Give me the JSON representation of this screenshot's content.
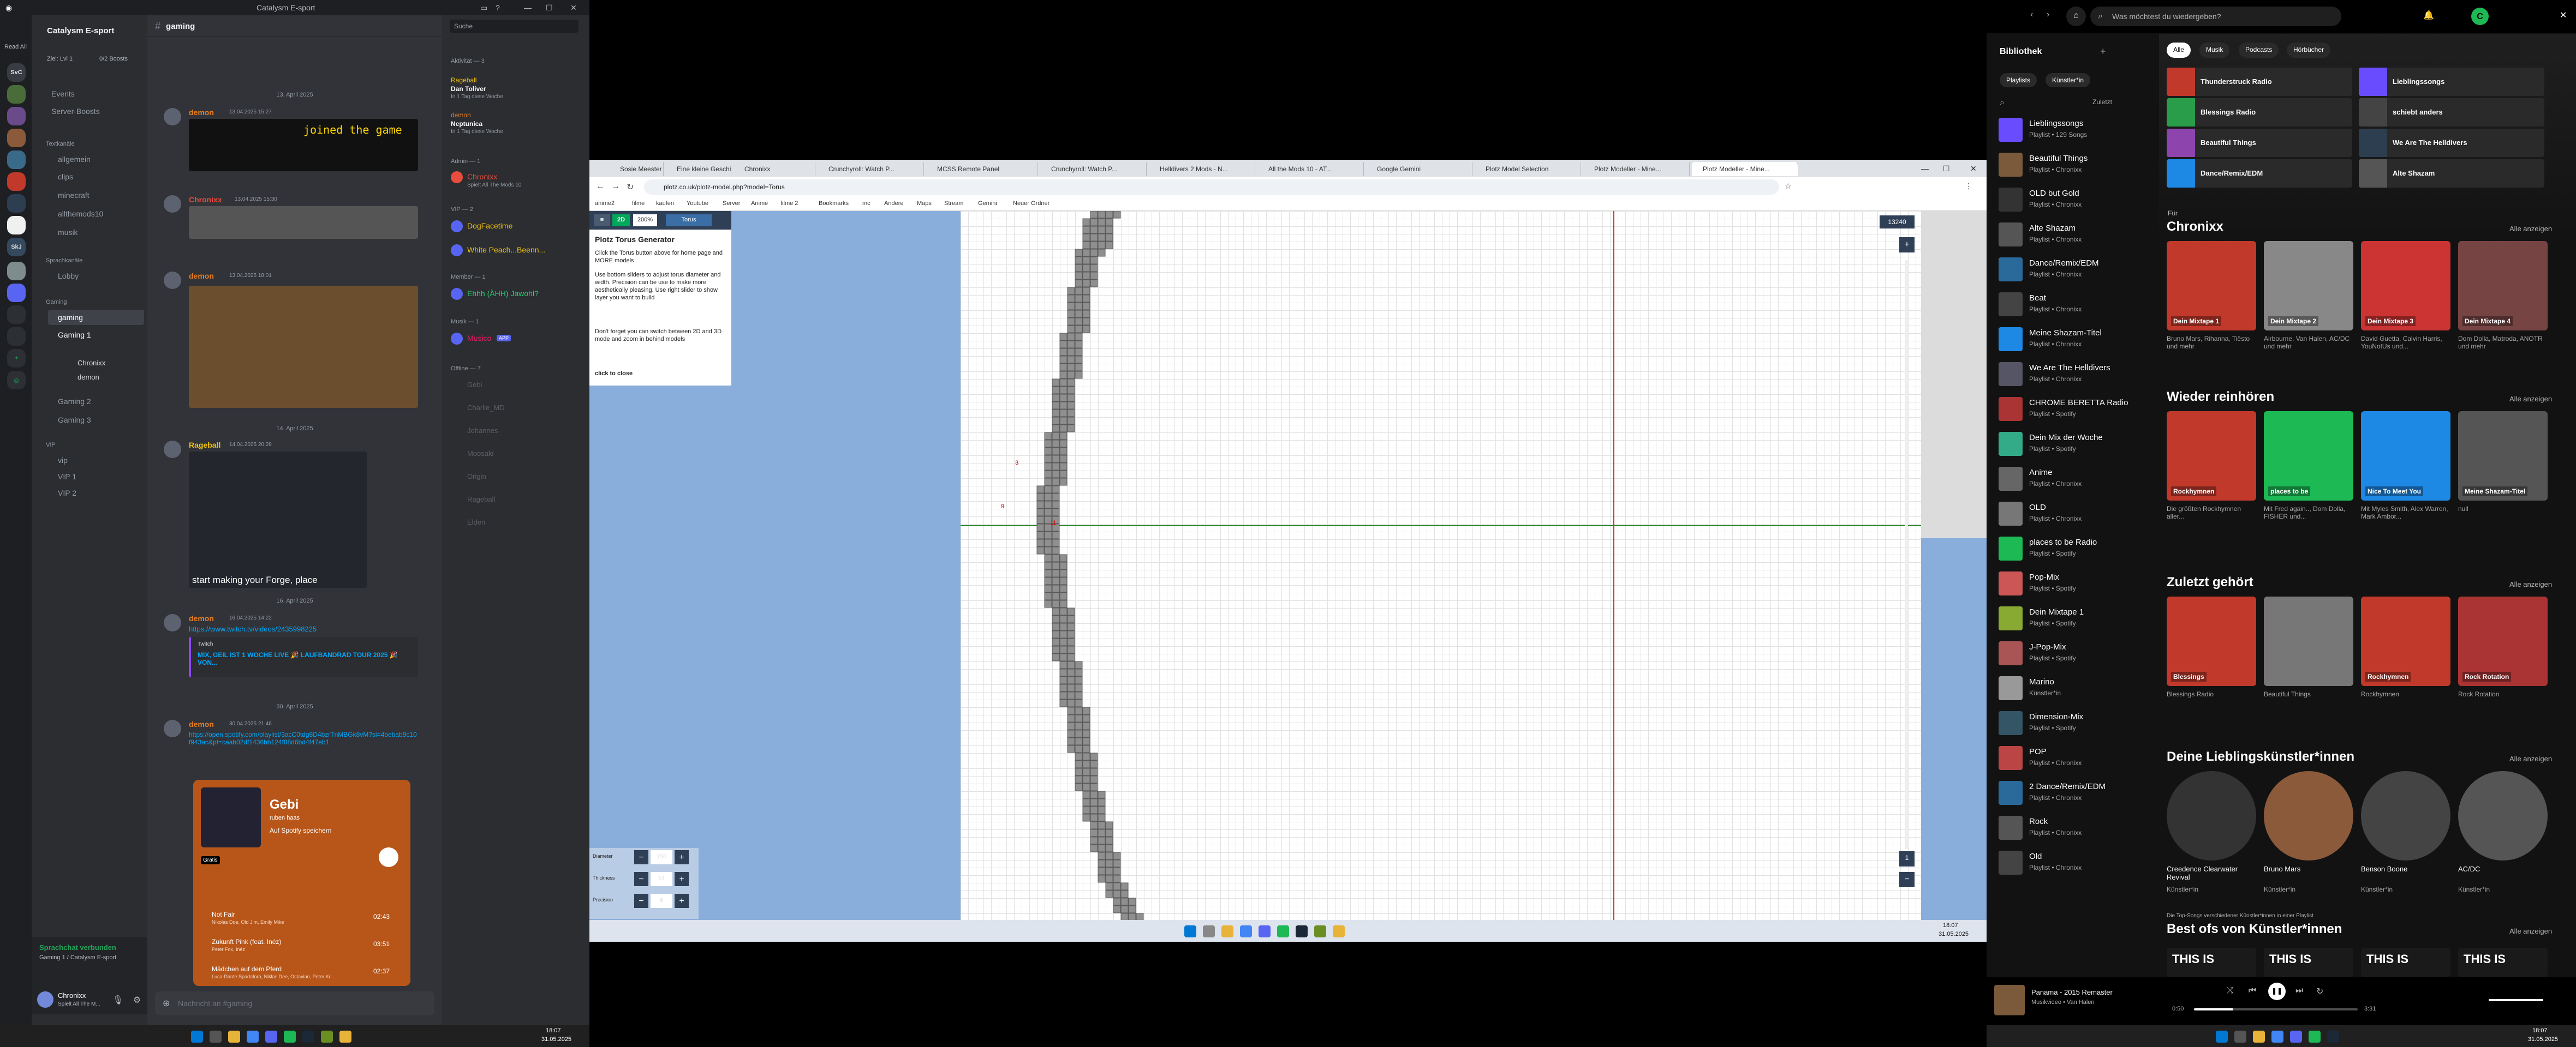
{
  "discord": {
    "title": "Catalysm E-sport",
    "read_all": "Read All",
    "server_name": "Catalysm E-sport",
    "level": "Ziel: Lvl 1",
    "boosts": "0/2 Boosts",
    "channels_top": [
      "Events",
      "Server-Boosts"
    ],
    "cat_text": "Textkanäle",
    "text_channels": [
      "allgemein",
      "clips",
      "minecraft",
      "allthemods10",
      "musik"
    ],
    "cat_voice": "Sprachkanäle",
    "voice_channels": [
      "Lobby"
    ],
    "cat_gaming": "Gaming",
    "gaming_channels": [
      "gaming",
      "Gaming 1",
      "Gaming 2",
      "Gaming 3"
    ],
    "voice_users": [
      "Chronixx",
      "demon"
    ],
    "cat_vip": "VIP",
    "vip_channels": [
      "vip",
      "VIP 1",
      "VIP 2"
    ],
    "channel_header": "gaming",
    "search_placeholder": "Suche",
    "voice_status": "Sprachchat verbunden",
    "voice_sub": "Gaming 1 / Catalysm E-sport",
    "user": "Chronixx",
    "user_status": "Spielt All The M...",
    "input_placeholder": "Nachricht an #gaming",
    "dates": [
      "13. April 2025",
      "14. April 2025",
      "16. April 2025",
      "30. April 2025"
    ],
    "messages": [
      {
        "author": "demon",
        "time": "13.04.2025 15:27",
        "text": "joined the game",
        "color": "#e67e22"
      },
      {
        "author": "Chronixx",
        "time": "13.04.2025 15:30",
        "text": "",
        "color": "#e74c3c"
      },
      {
        "author": "demon",
        "time": "13.04.2025 18:01",
        "text": "",
        "color": "#e67e22"
      },
      {
        "author": "Rageball",
        "time": "14.04.2025 20:28",
        "text": "start making your Forge, place",
        "color": "#f1c40f"
      },
      {
        "author": "demon",
        "time": "16.04.2025 14:22",
        "text": "https://www.twitch.tv/videos/2435998225",
        "color": "#e67e22"
      },
      {
        "author": "demon",
        "time": "30.04.2025 21:46",
        "text": "https://open.spotify.com/playlist/3acC0tdg8D4bzrTnMBGk8vM?si=4bebab9c10f943ac&pt=caab02df1436bb124f88d6bd4f47eb1",
        "color": "#e67e22"
      }
    ],
    "twitch_embed": {
      "provider": "Twitch",
      "title": "MIX, GEIL IST 1 WOCHE LIVE 🎉 LAUFBANDRAD TOUR 2025 🎉 VON..."
    },
    "spotify_embed": {
      "title": "Gebi",
      "owner": "ruben haas",
      "save": "Auf Spotify speichern",
      "badge": "Gratis",
      "tracks": [
        {
          "name": "Not Fair",
          "artist": "Nikolas Doe, Old Jim, Emily Mike",
          "dur": "02:43"
        },
        {
          "name": "Zukunft Pink (feat. Inéz)",
          "artist": "Peter Fox, Inéz",
          "dur": "03:51"
        },
        {
          "name": "Mädchen auf dem Pferd",
          "artist": "Luca-Dante Spadafora, Niklas Dee, Octavian, Peter Kr...",
          "dur": "02:37"
        }
      ]
    },
    "members": {
      "activity_header": "Aktivität — 3",
      "activity": [
        {
          "name": "Rageball",
          "sub": "Dan Toliver",
          "note": "In 1 Tag diese Woche"
        },
        {
          "name": "demon",
          "sub": "Neptunica",
          "note": "In 1 Tag diese Woche"
        }
      ],
      "admin_header": "Admin — 1",
      "admins": [
        {
          "name": "Chronixx",
          "sub": "Spielt All The Mods 10",
          "color": "#e74c3c"
        }
      ],
      "vip_header": "VIP — 2",
      "vips": [
        {
          "name": "DogFacetime",
          "color": "#f1c40f"
        },
        {
          "name": "White Peach...Beenn...",
          "color": "#f1c40f"
        }
      ],
      "member_header": "Member — 1",
      "members": [
        {
          "name": "Ehhh (ÄHH) Jawohl?",
          "color": "#2ecc71"
        }
      ],
      "musik_header": "Musik — 1",
      "musik": [
        {
          "name": "Musico",
          "badge": "APP",
          "color": "#e91e63"
        }
      ],
      "offline_header": "Offline — 7",
      "offline": [
        "Gebi",
        "Charlie_MD",
        "Johannes",
        "Moosaki",
        "Origin",
        "Rageball",
        "Elden"
      ]
    }
  },
  "browser": {
    "tabs": [
      "Sosie Meester - (A...",
      "Eine kleine Geschichte...",
      "Chronixx",
      "Crunchyroll: Watch P...",
      "MCSS Remote Panel",
      "Crunchyroll: Watch P...",
      "Helldivers 2 Mods - N...",
      "All the Mods 10 - AT...",
      "Google Gemini",
      "Plotz Model Selection",
      "Plotz Modeller - Mine...",
      "Plotz Modeller - Mine..."
    ],
    "url": "plotz.co.uk/plotz-model.php?model=Torus",
    "bookmarks": [
      "anime2",
      "filme",
      "kaufen",
      "Youtube",
      "Server",
      "Anime",
      "filme 2",
      "Bookmarks",
      "mc",
      "Andere",
      "Maps",
      "Stream",
      "Gemini",
      "Neuer Ordner"
    ],
    "plotz": {
      "btn_2d": "2D",
      "zoom": "200%",
      "shape": "Torus",
      "counter": "13240",
      "title": "Plotz Torus Generator",
      "help": [
        "Click the Torus button above for home page and MORE models",
        "Use bottom sliders to adjust torus diameter and width. Precision can be use to make more aesthetically pleasing. Use right slider to show layer you want to build",
        "Don't forget you can switch between 2D and 3D mode and zoom in behind models"
      ],
      "close": "click to close",
      "sliders": [
        {
          "label": "Diameter",
          "value": "150"
        },
        {
          "label": "Thickness",
          "value": "14"
        },
        {
          "label": "Precision",
          "value": "6"
        }
      ],
      "layer_marks": [
        "3",
        "9",
        "11"
      ]
    }
  },
  "spotify": {
    "search_placeholder": "Was möchtest du wiedergeben?",
    "library_title": "Bibliothek",
    "lib_filters": [
      "Playlists",
      "Künstler*in"
    ],
    "sort": "Zuletzt",
    "library": [
      {
        "title": "Lieblingssongs",
        "sub": "Playlist • 129 Songs"
      },
      {
        "title": "Beautiful Things",
        "sub": "Playlist • Chronixx"
      },
      {
        "title": "OLD but Gold",
        "sub": "Playlist • Chronixx"
      },
      {
        "title": "Alte Shazam",
        "sub": "Playlist • Chronixx"
      },
      {
        "title": "Dance/Remix/EDM",
        "sub": "Playlist • Chronixx"
      },
      {
        "title": "Beat",
        "sub": "Playlist • Chronixx"
      },
      {
        "title": "Meine Shazam-Titel",
        "sub": "Playlist • Chronixx"
      },
      {
        "title": "We Are The Helldivers",
        "sub": "Playlist • Chronixx"
      },
      {
        "title": "CHROME BERETTA Radio",
        "sub": "Playlist • Spotify"
      },
      {
        "title": "Dein Mix der Woche",
        "sub": "Playlist • Spotify"
      },
      {
        "title": "Anime",
        "sub": "Playlist • Chronixx"
      },
      {
        "title": "OLD",
        "sub": "Playlist • Chronixx"
      },
      {
        "title": "places to be Radio",
        "sub": "Playlist • Spotify"
      },
      {
        "title": "Pop-Mix",
        "sub": "Playlist • Spotify"
      },
      {
        "title": "Dein Mixtape 1",
        "sub": "Playlist • Spotify"
      },
      {
        "title": "J-Pop-Mix",
        "sub": "Playlist • Spotify"
      },
      {
        "title": "Marino",
        "sub": "Künstler*in"
      },
      {
        "title": "Dimension-Mix",
        "sub": "Playlist • Spotify"
      },
      {
        "title": "POP",
        "sub": "Playlist • Chronixx"
      },
      {
        "title": "2 Dance/Remix/EDM",
        "sub": "Playlist • Chronixx"
      },
      {
        "title": "Rock",
        "sub": "Playlist • Chronixx"
      },
      {
        "title": "Old",
        "sub": "Playlist • Chronixx"
      }
    ],
    "chips": [
      "Alle",
      "Musik",
      "Podcasts",
      "Hörbücher"
    ],
    "quick": [
      "Thunderstruck Radio",
      "Lieblingssongs",
      "Blessings Radio",
      "schiebt anders",
      "Beautiful Things",
      "We Are The Helldivers",
      "Dance/Remix/EDM",
      "Alte Shazam"
    ],
    "show_all": "Alle anzeigen",
    "for_label": "Für",
    "sections": [
      {
        "title": "Chronixx",
        "cards": [
          {
            "label": "Dein Mixtape 1",
            "cap": "Bruno Mars, Rihanna, Tiësto und mehr"
          },
          {
            "label": "Dein Mixtape 2",
            "cap": "Airbourne, Van Halen, AC/DC und mehr"
          },
          {
            "label": "Dein Mixtape 3",
            "cap": "David Guetta, Calvin Harris, YouNotUs und..."
          },
          {
            "label": "Dein Mixtape 4",
            "cap": "Dom Dolla, Matroda, ANOTR und mehr"
          }
        ]
      },
      {
        "title": "Wieder reinhören",
        "cards": [
          {
            "label": "Rockhymnen",
            "cap": "Die größten Rockhymnen aller..."
          },
          {
            "label": "places to be",
            "cap": "Mit Fred again.., Dom Dolla, FISHER und..."
          },
          {
            "label": "Nice To Meet You",
            "cap": "Mit Myles Smith, Alex Warren, Mark Ambor..."
          },
          {
            "label": "Meine Shazam-Titel",
            "cap": "null"
          }
        ]
      },
      {
        "title": "Zuletzt gehört",
        "cards": [
          {
            "label": "Blessings",
            "cap": "Blessings Radio"
          },
          {
            "label": "",
            "cap": "Beautiful Things"
          },
          {
            "label": "Rockhymnen",
            "cap": "Rockhymnen"
          },
          {
            "label": "Rock Rotation",
            "cap": "Rock Rotation"
          }
        ]
      },
      {
        "title": "Deine Lieblingskünstler*innen",
        "cards": [
          {
            "label": "",
            "cap": "Creedence Clearwater Revival"
          },
          {
            "label": "",
            "cap": "Bruno Mars"
          },
          {
            "label": "",
            "cap": "Benson Boone"
          },
          {
            "label": "",
            "cap": "AC/DC"
          }
        ]
      }
    ],
    "artist_sub": "Künstler*in",
    "top_songs_note": "Die Top-Songs verschiedener Künstler*innen in einer Playlist",
    "best_of_title": "Best ofs von Künstler*innen",
    "this_is": "THIS IS",
    "now_playing": {
      "title": "Panama - 2015 Remaster",
      "artist": "Musikvideo • Van Halen",
      "elapsed": "0:50",
      "duration": "3:31",
      "progress": 0.24
    }
  },
  "taskbar": {
    "time": "18:07",
    "date": "31.05.2025"
  }
}
